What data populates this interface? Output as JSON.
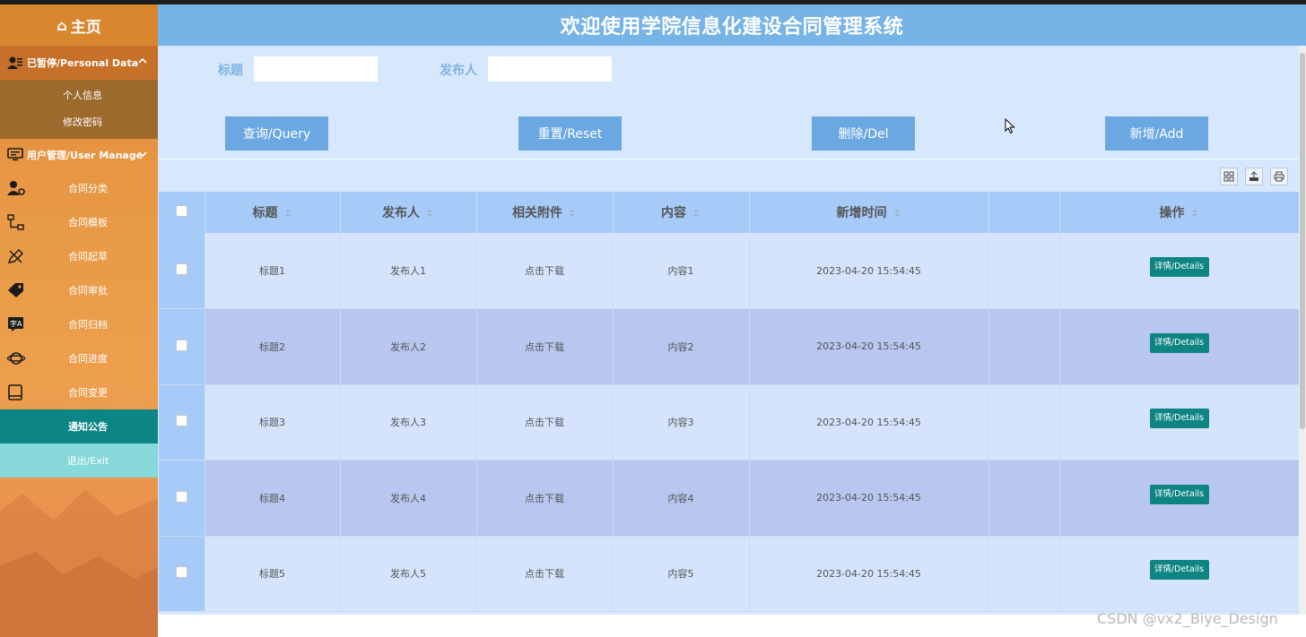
{
  "header": {
    "title": "欢迎使用学院信息化建设合同管理系统"
  },
  "sidebar": {
    "home": {
      "label": "主页"
    },
    "personal": {
      "label": "已暂停/Personal Data",
      "items": [
        {
          "label": "个人信息"
        },
        {
          "label": "修改密码"
        }
      ]
    },
    "user_manage": {
      "label": "用户管理/User Manage"
    },
    "nav": [
      {
        "label": "合同分类",
        "icon": "user-gear-icon"
      },
      {
        "label": "合同模板",
        "icon": "sitemap-icon"
      },
      {
        "label": "合同起草",
        "icon": "pencil-ruler-icon"
      },
      {
        "label": "合同审批",
        "icon": "tag-icon"
      },
      {
        "label": "合同归档",
        "icon": "translate-icon"
      },
      {
        "label": "合同进度",
        "icon": "planet-icon"
      },
      {
        "label": "合同变更",
        "icon": "book-icon"
      }
    ],
    "notice": {
      "label": "通知公告"
    },
    "exit": {
      "label": "退出/Exit"
    }
  },
  "search": {
    "title_label": "标题",
    "title_value": "",
    "publisher_label": "发布人",
    "publisher_value": ""
  },
  "buttons": {
    "query": "查询/Query",
    "reset": "重置/Reset",
    "delete": "删除/Del",
    "add": "新增/Add"
  },
  "table": {
    "columns": [
      "标题",
      "发布人",
      "相关附件",
      "内容",
      "新增时间",
      "",
      "操作"
    ],
    "rows": [
      {
        "title": "标题1",
        "publisher": "发布人1",
        "attachment": "点击下载",
        "content": "内容1",
        "time": "2023-04-20 15:54:45",
        "action": "详情/Details"
      },
      {
        "title": "标题2",
        "publisher": "发布人2",
        "attachment": "点击下载",
        "content": "内容2",
        "time": "2023-04-20 15:54:45",
        "action": "详情/Details"
      },
      {
        "title": "标题3",
        "publisher": "发布人3",
        "attachment": "点击下载",
        "content": "内容3",
        "time": "2023-04-20 15:54:45",
        "action": "详情/Details"
      },
      {
        "title": "标题4",
        "publisher": "发布人4",
        "attachment": "点击下载",
        "content": "内容4",
        "time": "2023-04-20 15:54:45",
        "action": "详情/Details"
      },
      {
        "title": "标题5",
        "publisher": "发布人5",
        "attachment": "点击下载",
        "content": "内容5",
        "time": "2023-04-20 15:54:45",
        "action": "详情/Details"
      }
    ]
  },
  "watermark": "CSDN @vx2_Biye_Design",
  "colors": {
    "header_bg": "#76b3e7",
    "sidebar_bg": "#e89a46",
    "main_bg": "#d7e7fe",
    "button_bg": "#6ba7e0",
    "detail_button_bg": "#0e8582",
    "notice_bg": "#0b8685",
    "exit_bg": "#86d8d9"
  }
}
